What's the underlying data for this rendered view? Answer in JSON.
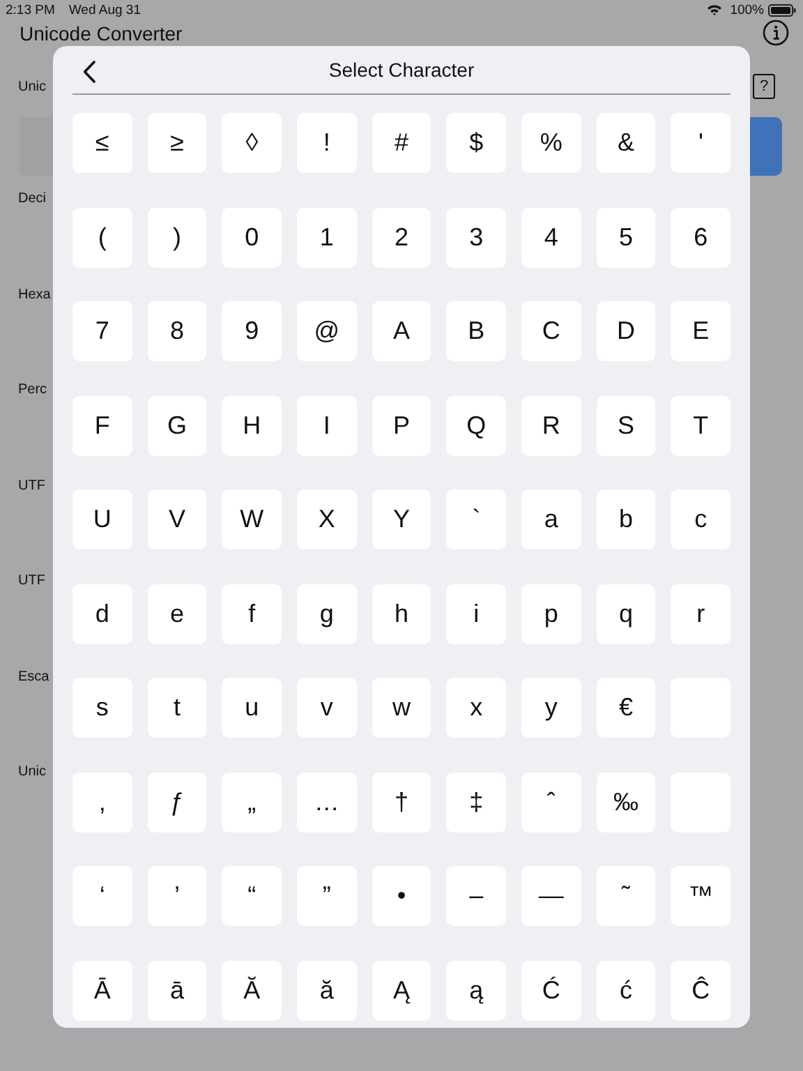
{
  "status_bar": {
    "time": "2:13 PM",
    "date": "Wed Aug 31",
    "battery": "100%"
  },
  "app": {
    "title": "Unicode Converter",
    "help": "?",
    "field_labels": [
      "Unic",
      "Deci",
      "Hexa",
      "Perc",
      "UTF",
      "UTF",
      "Esca",
      "Unic"
    ]
  },
  "sheet": {
    "title": "Select Character",
    "rows": [
      [
        {
          "kind": "char",
          "char": "≤"
        },
        {
          "kind": "char",
          "char": "≥"
        },
        {
          "kind": "char",
          "char": "◊"
        },
        {
          "kind": "char",
          "char": "!"
        },
        {
          "kind": "char",
          "char": "#"
        },
        {
          "kind": "char",
          "char": "$"
        },
        {
          "kind": "char",
          "char": "%"
        },
        {
          "kind": "char",
          "char": "&"
        },
        {
          "kind": "char",
          "char": "'"
        }
      ],
      [
        {
          "kind": "char",
          "char": "("
        },
        {
          "kind": "char",
          "char": ")"
        },
        {
          "kind": "char",
          "char": "0"
        },
        {
          "kind": "char",
          "char": "1"
        },
        {
          "kind": "char",
          "char": "2"
        },
        {
          "kind": "char",
          "char": "3"
        },
        {
          "kind": "char",
          "char": "4"
        },
        {
          "kind": "char",
          "char": "5"
        },
        {
          "kind": "char",
          "char": "6"
        }
      ],
      [
        {
          "kind": "char",
          "char": "7"
        },
        {
          "kind": "char",
          "char": "8"
        },
        {
          "kind": "char",
          "char": "9"
        },
        {
          "kind": "char",
          "char": "@"
        },
        {
          "kind": "char",
          "char": "A"
        },
        {
          "kind": "char",
          "char": "B"
        },
        {
          "kind": "char",
          "char": "C"
        },
        {
          "kind": "char",
          "char": "D"
        },
        {
          "kind": "char",
          "char": "E"
        }
      ],
      [
        {
          "kind": "char",
          "char": "F"
        },
        {
          "kind": "char",
          "char": "G"
        },
        {
          "kind": "char",
          "char": "H"
        },
        {
          "kind": "char",
          "char": "I"
        },
        {
          "kind": "char",
          "char": "P"
        },
        {
          "kind": "char",
          "char": "Q"
        },
        {
          "kind": "char",
          "char": "R"
        },
        {
          "kind": "char",
          "char": "S"
        },
        {
          "kind": "char",
          "char": "T"
        }
      ],
      [
        {
          "kind": "char",
          "char": "U"
        },
        {
          "kind": "char",
          "char": "V"
        },
        {
          "kind": "char",
          "char": "W"
        },
        {
          "kind": "char",
          "char": "X"
        },
        {
          "kind": "char",
          "char": "Y"
        },
        {
          "kind": "char",
          "char": "`"
        },
        {
          "kind": "char",
          "char": "a"
        },
        {
          "kind": "char",
          "char": "b"
        },
        {
          "kind": "char",
          "char": "c"
        }
      ],
      [
        {
          "kind": "char",
          "char": "d"
        },
        {
          "kind": "char",
          "char": "e"
        },
        {
          "kind": "char",
          "char": "f"
        },
        {
          "kind": "char",
          "char": "g"
        },
        {
          "kind": "char",
          "char": "h"
        },
        {
          "kind": "char",
          "char": "i"
        },
        {
          "kind": "char",
          "char": "p"
        },
        {
          "kind": "char",
          "char": "q"
        },
        {
          "kind": "char",
          "char": "r"
        }
      ],
      [
        {
          "kind": "char",
          "char": "s"
        },
        {
          "kind": "char",
          "char": "t"
        },
        {
          "kind": "char",
          "char": "u"
        },
        {
          "kind": "char",
          "char": "v"
        },
        {
          "kind": "char",
          "char": "w"
        },
        {
          "kind": "char",
          "char": "x"
        },
        {
          "kind": "char",
          "char": "y"
        },
        {
          "kind": "char",
          "char": "€"
        },
        {
          "kind": "blank"
        }
      ],
      [
        {
          "kind": "char",
          "char": "‚"
        },
        {
          "kind": "char",
          "char": "ƒ"
        },
        {
          "kind": "char",
          "char": "„"
        },
        {
          "kind": "char",
          "char": "…"
        },
        {
          "kind": "char",
          "char": "†"
        },
        {
          "kind": "char",
          "char": "‡"
        },
        {
          "kind": "char",
          "char": "ˆ"
        },
        {
          "kind": "char",
          "char": "‰"
        },
        {
          "kind": "blank"
        }
      ],
      [
        {
          "kind": "char",
          "char": "‘"
        },
        {
          "kind": "char",
          "char": "’"
        },
        {
          "kind": "char",
          "char": "“"
        },
        {
          "kind": "char",
          "char": "”"
        },
        {
          "kind": "char",
          "char": "•"
        },
        {
          "kind": "char",
          "char": "–"
        },
        {
          "kind": "char",
          "char": "—"
        },
        {
          "kind": "char",
          "char": "˜"
        },
        {
          "kind": "char",
          "char": "™"
        }
      ],
      [
        {
          "kind": "char",
          "char": "Ā"
        },
        {
          "kind": "char",
          "char": "ā"
        },
        {
          "kind": "char",
          "char": "Ă"
        },
        {
          "kind": "char",
          "char": "ă"
        },
        {
          "kind": "char",
          "char": "Ą"
        },
        {
          "kind": "char",
          "char": "ą"
        },
        {
          "kind": "char",
          "char": "Ć"
        },
        {
          "kind": "char",
          "char": "ć"
        },
        {
          "kind": "char",
          "char": "Ĉ"
        }
      ]
    ]
  }
}
